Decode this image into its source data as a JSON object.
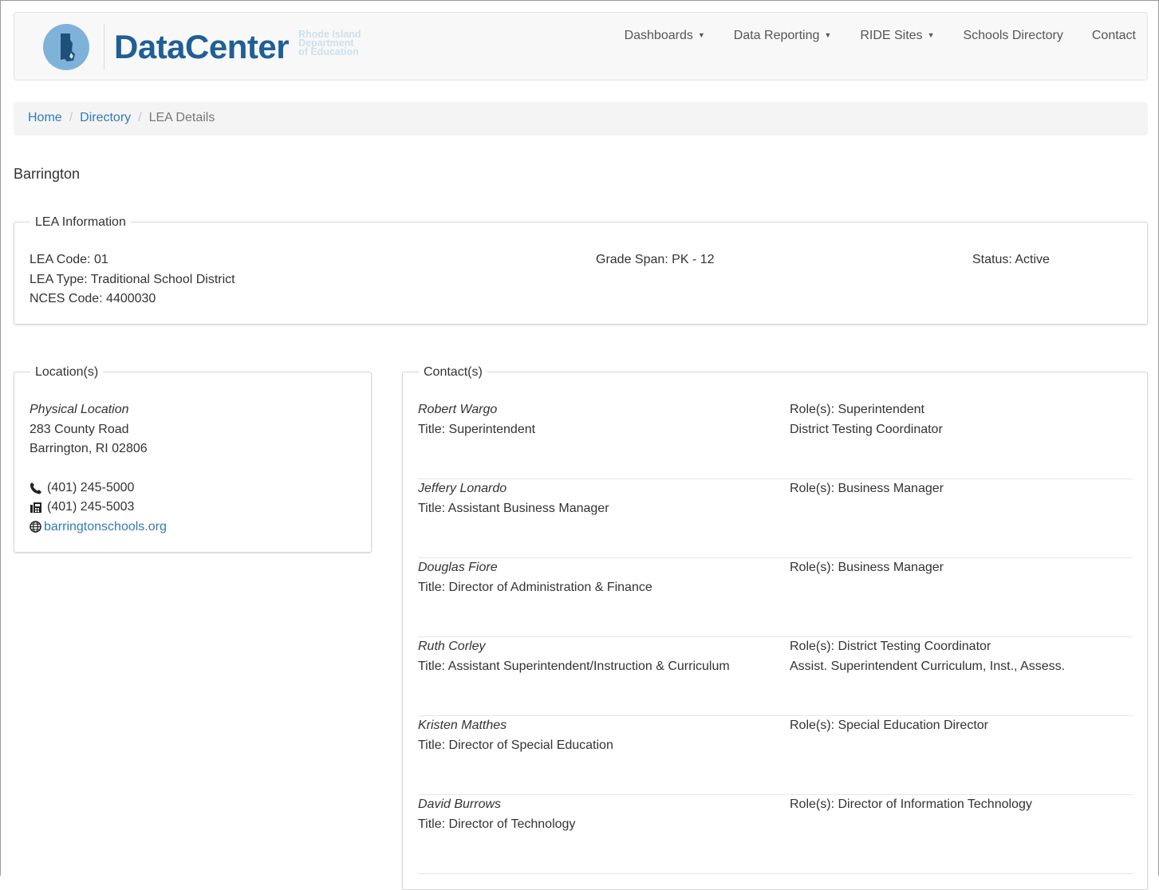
{
  "brand": {
    "name": "DataCenter",
    "sub": [
      "Rhode Island",
      "Department",
      "of Education"
    ],
    "logo_color": "#7fb2d8",
    "name_color": "#1f5f96"
  },
  "nav": [
    {
      "label": "Dashboards",
      "dropdown": true
    },
    {
      "label": "Data Reporting",
      "dropdown": true
    },
    {
      "label": "RIDE Sites",
      "dropdown": true
    },
    {
      "label": "Schools Directory",
      "dropdown": false
    },
    {
      "label": "Contact",
      "dropdown": false
    }
  ],
  "breadcrumb": {
    "home": "Home",
    "directory": "Directory",
    "current": "LEA Details",
    "separator": "/"
  },
  "page_title": "Barrington",
  "lea_info": {
    "legend": "LEA Information",
    "code": "LEA Code: 01",
    "type": "LEA Type: Traditional School District",
    "nces": "NCES Code: 4400030",
    "grade_span": "Grade Span: PK - 12",
    "status": "Status: Active"
  },
  "locations": {
    "legend": "Location(s)",
    "label": "Physical Location",
    "address1": "283 County Road",
    "address2": "Barrington, RI 02806",
    "phone": "(401) 245-5000",
    "fax": "(401) 245-5003",
    "website": "barringtonschools.org",
    "icons": [
      "phone-icon",
      "fax-icon",
      "globe-icon"
    ]
  },
  "contacts": {
    "legend": "Contact(s)",
    "items": [
      {
        "name": "Robert Wargo",
        "title": "Title: Superintendent",
        "roles": [
          "Role(s): Superintendent",
          "District Testing Coordinator"
        ]
      },
      {
        "name": "Jeffery Lonardo",
        "title": "Title: Assistant Business Manager",
        "roles": [
          "Role(s): Business Manager"
        ]
      },
      {
        "name": "Douglas Fiore",
        "title": "Title: Director of Administration & Finance",
        "roles": [
          "Role(s): Business Manager"
        ]
      },
      {
        "name": "Ruth Corley",
        "title": "Title: Assistant Superintendent/Instruction & Curriculum",
        "roles": [
          "Role(s): District Testing Coordinator",
          "Assist. Superintendent Curriculum, Inst., Assess."
        ]
      },
      {
        "name": "Kristen Matthes",
        "title": "Title: Director of Special Education",
        "roles": [
          "Role(s): Special Education Director"
        ]
      },
      {
        "name": "David Burrows",
        "title": "Title: Director of Technology",
        "roles": [
          "Role(s): Director of Information Technology"
        ]
      }
    ]
  }
}
